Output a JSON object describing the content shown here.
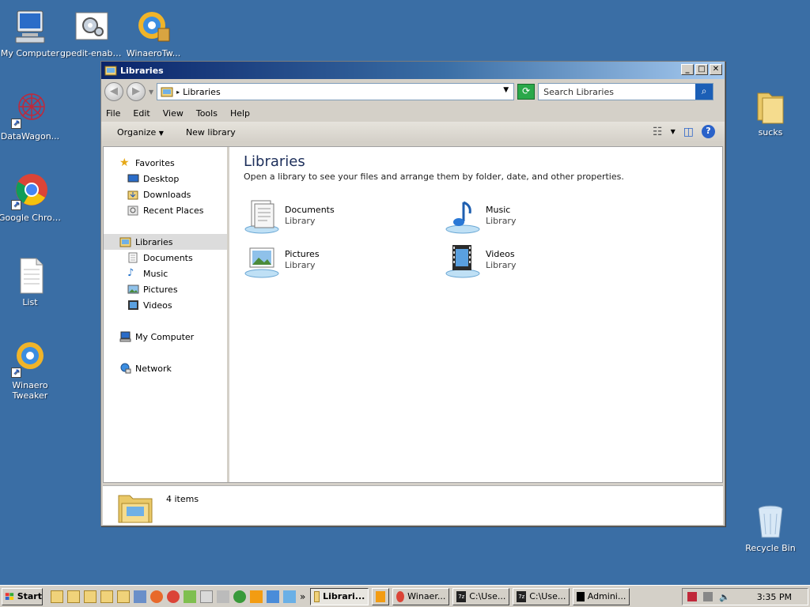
{
  "desktop": {
    "icons_left": [
      {
        "label": "My Computer",
        "icon": "computer-icon"
      },
      {
        "label": "gpedit-enabler",
        "icon": "gear-file-icon"
      },
      {
        "label": "WinaeroTw...",
        "icon": "winaero-icon"
      },
      {
        "label": "DataWagon...",
        "icon": "datawagon-icon"
      },
      {
        "label": "Google Chrome",
        "icon": "chrome-icon"
      },
      {
        "label": "List",
        "icon": "text-file-icon"
      },
      {
        "label": "Winaero Tweaker",
        "icon": "winaero-icon"
      }
    ],
    "icons_right": [
      {
        "label": "sucks",
        "icon": "folder-icon"
      },
      {
        "label": "Recycle Bin",
        "icon": "recycle-bin-icon"
      }
    ]
  },
  "window": {
    "title": "Libraries",
    "address": "Libraries",
    "search_placeholder": "Search Libraries",
    "menu": [
      "File",
      "Edit",
      "View",
      "Tools",
      "Help"
    ],
    "toolbar": {
      "organize": "Organize",
      "new_library": "New library"
    },
    "nav": {
      "favorites": "Favorites",
      "favorites_items": [
        "Desktop",
        "Downloads",
        "Recent Places"
      ],
      "libraries": "Libraries",
      "libraries_items": [
        "Documents",
        "Music",
        "Pictures",
        "Videos"
      ],
      "computer": "My Computer",
      "network": "Network"
    },
    "main": {
      "title": "Libraries",
      "subtitle": "Open a library to see your files and arrange them by folder, date, and other properties.",
      "libraries": [
        {
          "name": "Documents",
          "kind": "Library"
        },
        {
          "name": "Music",
          "kind": "Library"
        },
        {
          "name": "Pictures",
          "kind": "Library"
        },
        {
          "name": "Videos",
          "kind": "Library"
        }
      ]
    },
    "details": {
      "count": "4 items"
    }
  },
  "taskbar": {
    "start": "Start",
    "tasks": [
      "Librari...",
      "Winaer...",
      "C:\\Use...",
      "C:\\Use...",
      "Admini..."
    ],
    "clock": "3:35 PM"
  }
}
